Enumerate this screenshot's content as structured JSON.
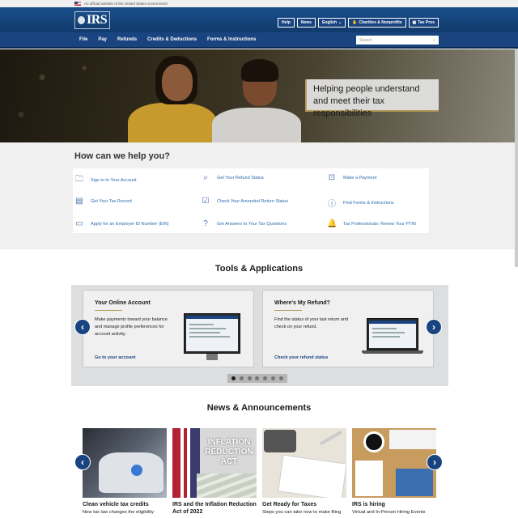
{
  "gov_banner": {
    "text": "An official website of the United States Government"
  },
  "header": {
    "logo": "IRS",
    "utility": [
      "Help",
      "News",
      "English",
      "Charities & Nonprofits",
      "Tax Pros"
    ]
  },
  "nav": {
    "items": [
      "File",
      "Pay",
      "Refunds",
      "Credits & Deductions",
      "Forms & Instructions"
    ],
    "search_placeholder": "Search"
  },
  "hero": {
    "tagline": "Helping people understand and meet their tax responsibilities"
  },
  "help": {
    "title": "How can we help you?",
    "links": [
      {
        "label": "Sign in to Your Account",
        "icon": "folder-icon"
      },
      {
        "label": "Get Your Refund Status",
        "icon": "magnifier-icon"
      },
      {
        "label": "Make a Payment",
        "icon": "money-icon"
      },
      {
        "label": "Get Your Tax Record",
        "icon": "document-icon"
      },
      {
        "label": "Check Your Amended Return Status",
        "icon": "checkbox-icon"
      },
      {
        "label": "Find Forms & Instructions",
        "icon": "info-icon"
      },
      {
        "label": "Apply for an Employer ID Number (EIN)",
        "icon": "laptop-icon"
      },
      {
        "label": "Get Answers to Your Tax Questions",
        "icon": "question-icon"
      },
      {
        "label": "Tax Professionals: Renew Your PTIN",
        "icon": "bell-icon"
      }
    ]
  },
  "tools": {
    "title": "Tools & Applications",
    "cards": [
      {
        "title": "Your Online Account",
        "body": "Make payments toward your balance and manage profile preferences for account activity.",
        "link": "Go to your account"
      },
      {
        "title": "Where's My Refund?",
        "body": "Find the status of your last return and check on your refund.",
        "link": "Check your refund status"
      }
    ],
    "slides": 7,
    "active_slide": 1
  },
  "news": {
    "title": "News & Announcements",
    "image_text": "INFLATION REDUCTION ACT",
    "cards": [
      {
        "title": "Clean vehicle tax credits",
        "desc": "New tax law changes the eligibility"
      },
      {
        "title": "IRS and the Inflation Reduction Act of 2022",
        "desc": ""
      },
      {
        "title": "Get Ready for Taxes",
        "desc": "Steps you can take now to make filing"
      },
      {
        "title": "IRS is hiring",
        "desc": "Virtual and In-Person Hiring Events"
      }
    ]
  },
  "colors": {
    "nav": "#1a4480",
    "accent": "#b59b5a",
    "link": "#2b6cb0"
  }
}
